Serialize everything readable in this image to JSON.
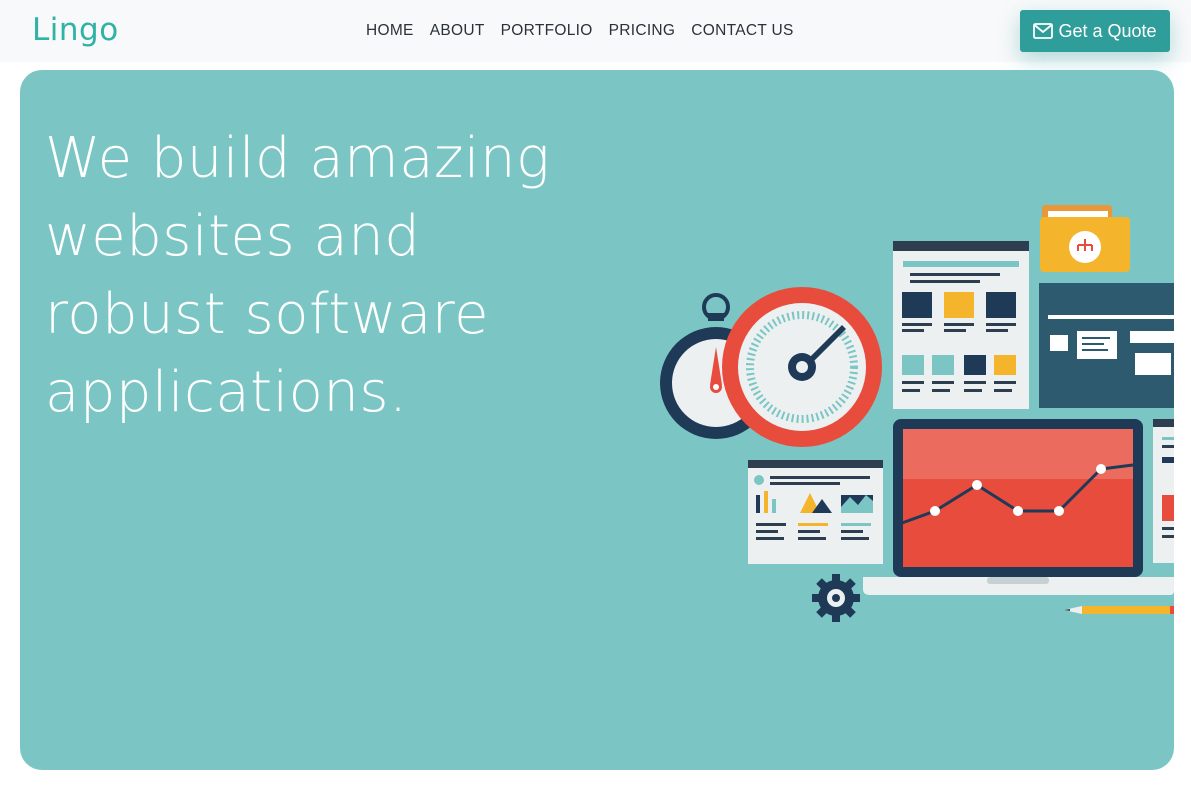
{
  "brand": {
    "name": "Lingo"
  },
  "nav": {
    "items": [
      {
        "label": "HOME"
      },
      {
        "label": "ABOUT"
      },
      {
        "label": "PORTFOLIO"
      },
      {
        "label": "PRICING"
      },
      {
        "label": "CONTACT US"
      }
    ]
  },
  "cta": {
    "label": "Get a Quote",
    "icon": "envelope-icon"
  },
  "hero": {
    "title": "We build amazing websites and robust software applications.",
    "illustration": "web-development-illustration"
  },
  "colors": {
    "accent": "#2fb3a5",
    "button": "#2f9e9a",
    "hero_bg": "#7bc6c4",
    "navbar_bg": "#f8f9fa"
  }
}
